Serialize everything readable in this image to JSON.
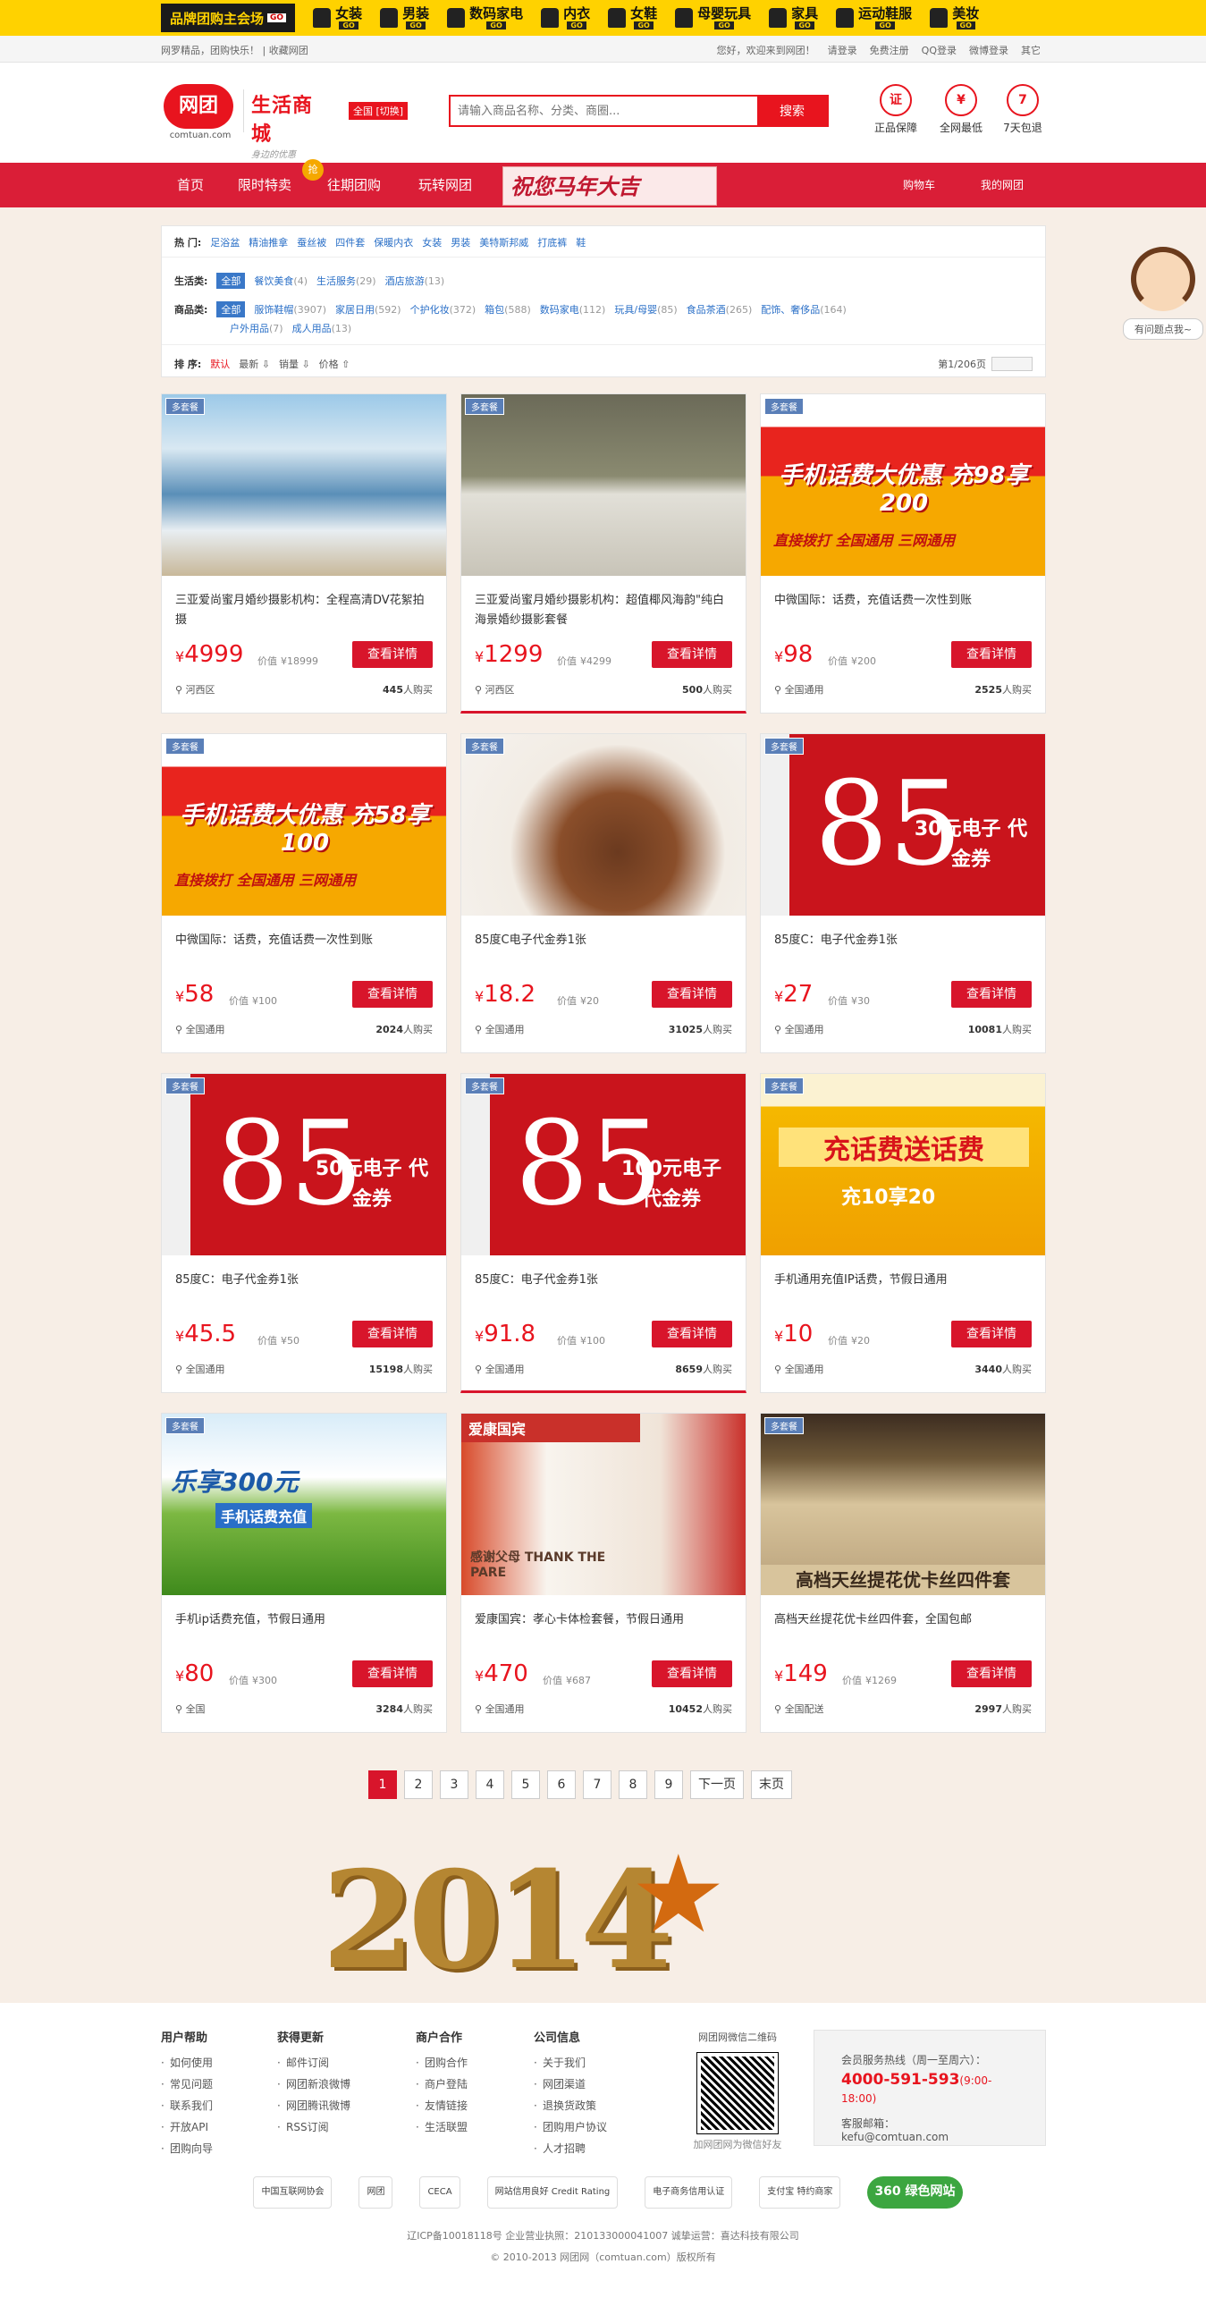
{
  "brandbar": {
    "logo": "品牌团购主会场",
    "go": "GO",
    "categories": [
      "女装",
      "男装",
      "数码家电",
      "内衣",
      "女鞋",
      "母婴玩具",
      "家具",
      "运动鞋服",
      "美妆"
    ]
  },
  "userbar": {
    "left": "网罗精品，团购快乐！ | 收藏网团",
    "links": [
      "您好，欢迎来到网团！",
      "请登录",
      "免费注册",
      "QQ登录",
      "微博登录",
      "其它"
    ]
  },
  "header": {
    "logo": "网团",
    "logo_sub": "comtuan.com",
    "sublogo": "生活商城",
    "sublogo_slogan": "身边的优惠",
    "city": "全国 [切换]",
    "search_placeholder": "请输入商品名称、分类、商圈...",
    "search_button": "搜索",
    "assurances": [
      {
        "icon": "证",
        "label": "正品保障"
      },
      {
        "icon": "¥",
        "label": "全网最低"
      },
      {
        "icon": "7",
        "label": "7天包退"
      }
    ]
  },
  "nav": {
    "items": [
      "首页",
      "限时特卖",
      "往期团购",
      "玩转网团"
    ],
    "hot": "抢",
    "banner": "祝您马年大吉",
    "right": [
      "购物车",
      "我的网团"
    ]
  },
  "filter": {
    "hot_label": "热  门:",
    "hot": [
      "足浴盆",
      "精油推拿",
      "蚕丝被",
      "四件套",
      "保暖内衣",
      "女装",
      "男装",
      "美特斯邦威",
      "打底裤",
      "鞋"
    ],
    "life_label": "生活类:",
    "life": [
      {
        "n": "全部",
        "c": ""
      },
      {
        "n": "餐饮美食",
        "c": "(4)"
      },
      {
        "n": "生活服务",
        "c": "(29)"
      },
      {
        "n": "酒店旅游",
        "c": "(13)"
      }
    ],
    "goods_label": "商品类:",
    "goods": [
      {
        "n": "全部",
        "c": ""
      },
      {
        "n": "服饰鞋帽",
        "c": "(3907)"
      },
      {
        "n": "家居日用",
        "c": "(592)"
      },
      {
        "n": "个护化妆",
        "c": "(372)"
      },
      {
        "n": "箱包",
        "c": "(588)"
      },
      {
        "n": "数码家电",
        "c": "(112)"
      },
      {
        "n": "玩具/母婴",
        "c": "(85)"
      },
      {
        "n": "食品茶酒",
        "c": "(265)"
      },
      {
        "n": "配饰、奢侈品",
        "c": "(164)"
      }
    ],
    "goods2": [
      {
        "n": "户外用品",
        "c": "(7)"
      },
      {
        "n": "成人用品",
        "c": "(13)"
      }
    ],
    "sort_label": "排  序:",
    "sorts": [
      "默认",
      "最新 ⇩",
      "销量 ⇩",
      "价格 ⇧"
    ],
    "page": "第1/206页"
  },
  "avatar_text": "有问题点我~",
  "tag": "多套餐",
  "labels": {
    "orig_prefix": "价值",
    "button": "查看详情",
    "buy_suffix": "人购买"
  },
  "products": [
    {
      "title": "三亚爱尚蜜月婚纱摄影机构：全程高清DV花絮拍摄",
      "price": "4999",
      "orig": "¥18999",
      "loc": "河西区",
      "sold": "445",
      "img": "beach"
    },
    {
      "title": "三亚爱尚蜜月婚纱摄影机构：超值椰风海韵\"纯白海景婚纱摄影套餐",
      "price": "1299",
      "orig": "¥4299",
      "loc": "河西区",
      "sold": "500",
      "img": "couple",
      "hl": true
    },
    {
      "title": "中微国际：话费，充值话费一次性到账",
      "price": "98",
      "orig": "¥200",
      "loc": "全国通用",
      "sold": "2525",
      "img": "phone",
      "adtext": "手机话费大优惠 充98享200",
      "adsub": "直接拨打 全国通用 三网通用"
    },
    {
      "title": "中微国际：话费，充值话费一次性到账",
      "price": "58",
      "orig": "¥100",
      "loc": "全国通用",
      "sold": "2024",
      "img": "phone",
      "adtext": "手机话费大优惠 充58享100",
      "adsub": "直接拨打 全国通用 三网通用"
    },
    {
      "title": "85度C电子代金券1张",
      "price": "18.2",
      "orig": "¥20",
      "loc": "全国通用",
      "sold": "31025",
      "img": "cake"
    },
    {
      "title": "85度C：电子代金券1张",
      "price": "27",
      "orig": "¥30",
      "loc": "全国通用",
      "sold": "10081",
      "img": "c85",
      "adtext": "30元电子 代金券"
    },
    {
      "title": "85度C：电子代金券1张",
      "price": "45.5",
      "orig": "¥50",
      "loc": "全国通用",
      "sold": "15198",
      "img": "c85",
      "adtext": "50元电子 代金券"
    },
    {
      "title": "85度C：电子代金券1张",
      "price": "91.8",
      "orig": "¥100",
      "loc": "全国通用",
      "sold": "8659",
      "img": "c85",
      "adtext": "100元电子 代金券",
      "hl": true
    },
    {
      "title": "手机通用充值IP话费，节假日通用",
      "price": "10",
      "orig": "¥20",
      "loc": "全国通用",
      "sold": "3440",
      "img": "coins",
      "adtext": "充话费送话费",
      "adsub": "充10享20"
    },
    {
      "title": "手机ip话费充值，节假日通用",
      "price": "80",
      "orig": "¥300",
      "loc": "全国",
      "sold": "3284",
      "img": "grass",
      "adtext": "乐享300元",
      "adsub": "手机话费充值"
    },
    {
      "title": "爱康国宾：孝心卡体检套餐，节假日通用",
      "price": "470",
      "orig": "¥687",
      "loc": "全国通用",
      "sold": "10452",
      "img": "elder",
      "adtext": "爱康国宾",
      "adsub": "感谢父母 THANK THE PARE"
    },
    {
      "title": "高档天丝提花优卡丝四件套，全国包邮",
      "price": "149",
      "orig": "¥1269",
      "loc": "全国配送",
      "sold": "2997",
      "img": "bed",
      "adtext": "高档天丝提花优卡丝四件套"
    }
  ],
  "pager": [
    "1",
    "2",
    "3",
    "4",
    "5",
    "6",
    "7",
    "8",
    "9",
    "下一页",
    "末页"
  ],
  "year": "2014",
  "footer": {
    "cols": [
      {
        "h": "用户帮助",
        "items": [
          "如何使用",
          "常见问题",
          "联系我们",
          "开放API",
          "团购向导"
        ]
      },
      {
        "h": "获得更新",
        "items": [
          "邮件订阅",
          "网团新浪微博",
          "网团腾讯微博",
          "RSS订阅"
        ]
      },
      {
        "h": "商户合作",
        "items": [
          "团购合作",
          "商户登陆",
          "友情链接",
          "生活联盟"
        ]
      },
      {
        "h": "公司信息",
        "items": [
          "关于我们",
          "网团渠道",
          "退换货政策",
          "团购用户协议",
          "人才招聘"
        ]
      }
    ],
    "qr_title": "网团网微信二维码",
    "qr_caption": "加网团网为微信好友",
    "hotline_label": "会员服务热线（周一至周六）：",
    "hotline": "4000-591-593",
    "hotline_hours": "(9:00-18:00)",
    "email_label": "客服邮箱：",
    "email": "kefu@comtuan.com",
    "badges": [
      "中国互联网协会",
      "网团",
      "CECA",
      "网站信用良好 Credit Rating",
      "电子商务信用认证",
      "支付宝 特约商家",
      "360 绿色网站"
    ],
    "icp": "辽ICP备10018118号   企业营业执照：210133000041007   诚挚运营：喜达科技有限公司",
    "copy": "© 2010-2013 网团网（comtuan.com）版权所有"
  },
  "colors": {
    "brand_red": "#d8152b",
    "yellow": "#ffd200",
    "link_blue": "#2a6fc7"
  }
}
